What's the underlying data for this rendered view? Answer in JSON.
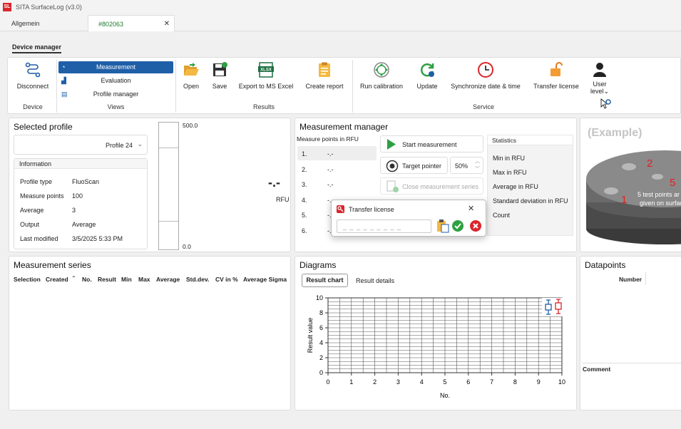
{
  "app": {
    "title": "SITA SurfaceLog (v3.0)",
    "logo": "SL"
  },
  "tabs": [
    {
      "label": "Allgemein"
    },
    {
      "label": "#802063"
    }
  ],
  "device_manager": {
    "label": "Device manager"
  },
  "ribbon": {
    "device": {
      "disconnect": "Disconnect",
      "group": "Device"
    },
    "views": {
      "items": [
        "Measurement",
        "Evaluation",
        "Profile manager"
      ],
      "group": "Views"
    },
    "results": {
      "open": "Open",
      "save": "Save",
      "export": "Export to MS Excel",
      "create_report": "Create report",
      "group": "Results"
    },
    "service": {
      "run_calibration": "Run calibration",
      "update": "Update",
      "sync": "Synchronize date & time",
      "transfer_license": "Transfer license",
      "group": "Service"
    },
    "user_level": {
      "line1": "User",
      "line2": "level"
    }
  },
  "selected_profile": {
    "title": "Selected profile",
    "profile": "Profile 24",
    "information_label": "Information",
    "fields": [
      {
        "label": "Profile type",
        "value": "FluoScan"
      },
      {
        "label": "Measure points",
        "value": "100"
      },
      {
        "label": "Average",
        "value": "3"
      },
      {
        "label": "Output",
        "value": "Average"
      },
      {
        "label": "Last modified",
        "value": "3/5/2025 5:33 PM"
      }
    ]
  },
  "gauge": {
    "max": "500.0",
    "min": "0.0",
    "value": "-.-",
    "unit": "RFU"
  },
  "measurement_manager": {
    "title": "Measurement manager",
    "points_header": "Measure points in RFU",
    "points": [
      {
        "n": "1.",
        "v": "-.-"
      },
      {
        "n": "2.",
        "v": "-.-"
      },
      {
        "n": "3.",
        "v": "-.-"
      },
      {
        "n": "4.",
        "v": "-.-"
      },
      {
        "n": "5.",
        "v": "-.-"
      },
      {
        "n": "6.",
        "v": "-.-"
      }
    ],
    "start": "Start measurement",
    "target": "Target pointer",
    "target_value": "50%",
    "close_series": "Close measurement series",
    "statistics_label": "Statistics",
    "statistics": [
      "Min in RFU",
      "Max in RFU",
      "Average in RFU",
      "Standard deviation in RFU",
      "Count"
    ]
  },
  "example": {
    "label": "(Example)",
    "caption_line1": "5 test points ar",
    "caption_line2": "given on surfac",
    "markers": [
      "1",
      "2",
      "5"
    ]
  },
  "series": {
    "title": "Measurement series",
    "columns": [
      "Selection",
      "Created",
      "No.",
      "Result",
      "Min",
      "Max",
      "Average",
      "Std.dev.",
      "CV in %",
      "Average Sigma"
    ]
  },
  "diagrams": {
    "title": "Diagrams",
    "tabs": [
      "Result chart",
      "Result details"
    ]
  },
  "datapoints": {
    "title": "Datapoints",
    "number": "Number",
    "comment": "Comment"
  },
  "license_dialog": {
    "title": "Transfer license",
    "placeholder": "_ _ _ _ _ _ _ _ _"
  },
  "colors": {
    "accent": "#1f5fa8",
    "green": "#2ea043",
    "red": "#d9262c",
    "tab_active_text": "#1d7a2e"
  },
  "chart_data": {
    "type": "scatter",
    "xlabel": "No.",
    "ylabel": "Result value",
    "xlim": [
      0,
      10
    ],
    "ylim": [
      0,
      10
    ],
    "x_ticks": [
      0,
      1,
      2,
      3,
      4,
      5,
      6,
      7,
      8,
      9,
      10
    ],
    "y_ticks": [
      0,
      2,
      4,
      6,
      8,
      10
    ],
    "grid": true,
    "series": []
  }
}
